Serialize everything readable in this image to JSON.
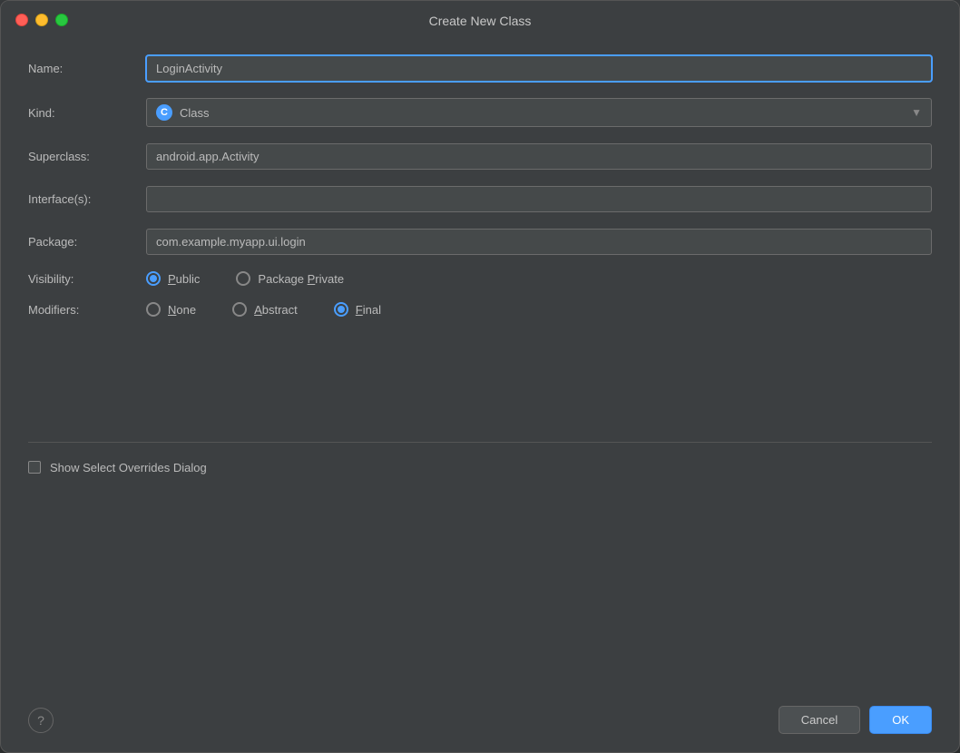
{
  "title_bar": {
    "title": "Create New Class"
  },
  "form": {
    "name_label": "Name:",
    "name_value": "LoginActivity",
    "kind_label": "Kind:",
    "kind_value": "Class",
    "kind_icon": "C",
    "superclass_label": "Superclass:",
    "superclass_value": "android.app.Activity",
    "interfaces_label": "Interface(s):",
    "interfaces_value": "",
    "package_label": "Package:",
    "package_value": "com.example.myapp.ui.login",
    "visibility_label": "Visibility:",
    "modifiers_label": "Modifiers:"
  },
  "visibility": {
    "options": [
      {
        "id": "public",
        "label": "Public",
        "selected": true,
        "underline_index": 1
      },
      {
        "id": "package_private",
        "label": "Package Private",
        "selected": false,
        "underline_index": 8
      }
    ]
  },
  "modifiers": {
    "options": [
      {
        "id": "none",
        "label": "None",
        "selected": false,
        "underline_index": 0
      },
      {
        "id": "abstract",
        "label": "Abstract",
        "selected": false,
        "underline_index": 0
      },
      {
        "id": "final",
        "label": "Final",
        "selected": true,
        "underline_index": 0
      }
    ]
  },
  "checkbox": {
    "label": "Show Select Overrides Dialog",
    "checked": false
  },
  "footer": {
    "help_label": "?",
    "cancel_label": "Cancel",
    "ok_label": "OK"
  }
}
